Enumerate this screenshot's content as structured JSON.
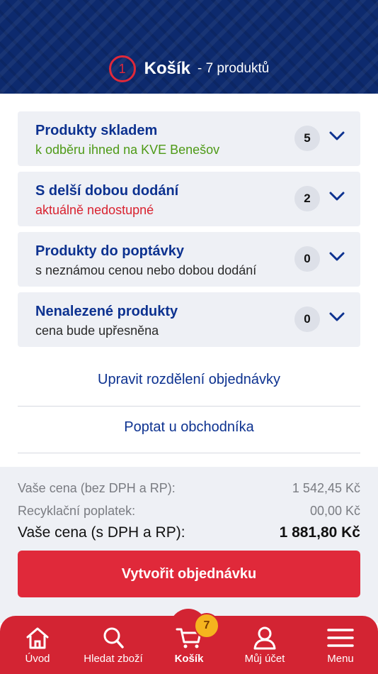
{
  "header": {
    "step_number": "1",
    "title": "Košík",
    "subtitle": "- 7 produktů"
  },
  "groups": [
    {
      "title": "Produkty skladem",
      "subtitle": "k odběru ihned na KVE Benešov",
      "count": "5",
      "status": "green"
    },
    {
      "title": "S delší dobou dodání",
      "subtitle": "aktuálně nedostupné",
      "count": "2",
      "status": "red"
    },
    {
      "title": "Produkty do poptávky",
      "subtitle": "s neznámou cenou nebo dobou dodání",
      "count": "0",
      "status": "neutral"
    },
    {
      "title": "Nenalezené produkty",
      "subtitle": "cena bude upřesněna",
      "count": "0",
      "status": "neutral"
    }
  ],
  "links": {
    "edit_split": "Upravit rozdělení objednávky",
    "ask_dealer": "Poptat u obchodníka"
  },
  "summary": {
    "price_no_vat_label": "Vaše cena (bez DPH a RP):",
    "price_no_vat_value": "1 542,45 Kč",
    "recycling_label": "Recyklační poplatek:",
    "recycling_value": "00,00 Kč",
    "price_vat_label": "Vaše cena (s DPH a RP):",
    "price_vat_value": "1 881,80 Kč",
    "order_button": "Vytvořit objednávku"
  },
  "nav": {
    "home": "Úvod",
    "search": "Hledat zboží",
    "cart": "Košík",
    "cart_count": "7",
    "account": "Můj účet",
    "menu": "Menu"
  },
  "colors": {
    "brand_blue": "#0d3290",
    "header_blue": "#0d2a6e",
    "accent_red": "#e0293a",
    "green": "#4e9a17",
    "badge_yellow": "#f5b41e"
  }
}
